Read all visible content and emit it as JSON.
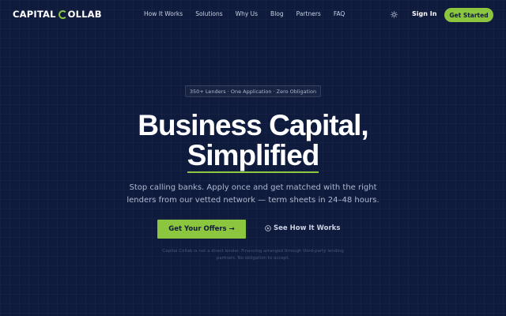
{
  "brand": {
    "name_part1": "CAPITAL ",
    "name_part2": "OLLAB"
  },
  "nav": {
    "links": [
      "How It Works",
      "Solutions",
      "Why Us",
      "Blog",
      "Partners",
      "FAQ"
    ],
    "sign_in": "Sign In",
    "get_started": "Get Started"
  },
  "hero": {
    "badge": "350+ Lenders · One Application · Zero Obligation",
    "headline_line1": "Business Capital,",
    "headline_line2": "Simplified",
    "subtext": "Stop calling banks. Apply once and get matched with the right lenders from our vetted network — term sheets in 24–48 hours.",
    "cta_primary": "Get Your Offers →",
    "cta_secondary": "See How It Works",
    "disclaimer": "Capital Collab is not a direct lender. Financing arranged through third-party lending partners. No obligation to accept."
  },
  "colors": {
    "background": "#0f1b3d",
    "accent": "#8cc63f",
    "text": "#ffffff",
    "muted": "#aeb8cf"
  },
  "icons": {
    "theme_toggle": "sun-icon",
    "secondary_cta": "play-circle-icon",
    "logo": "c-ring-icon"
  }
}
